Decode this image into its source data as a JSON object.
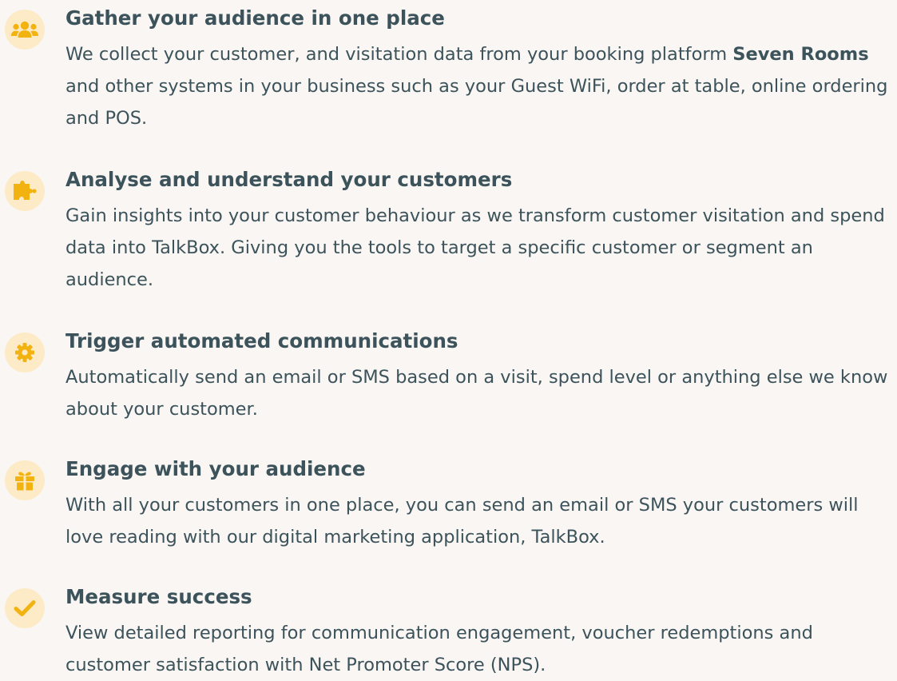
{
  "colors": {
    "background": "#f9f6f3",
    "text": "#3c535b",
    "icon_accent": "#f2b311",
    "icon_badge": "#fdebc7"
  },
  "features": [
    {
      "icon": "users-icon",
      "title": "Gather your audience in one place",
      "desc_part1": "We collect your customer, and visitation data from your booking platform ",
      "desc_bold": "Seven Rooms",
      "desc_part2": " and other systems in your business such as your Guest WiFi, order at table, online ordering and POS."
    },
    {
      "icon": "puzzle-icon",
      "title": "Analyse and understand your customers",
      "desc": "Gain insights into your customer behaviour as we transform customer visitation and spend data into TalkBox. Giving you the tools to target a specific customer or segment an audience."
    },
    {
      "icon": "gear-icon",
      "title": "Trigger automated communications",
      "desc": "Automatically send an email or SMS based on a visit, spend level or anything else we know about your customer."
    },
    {
      "icon": "gift-icon",
      "title": "Engage with your audience",
      "desc": "With all your customers in one place, you can send an email or SMS your customers will love reading with our digital marketing application, TalkBox."
    },
    {
      "icon": "checkmark-icon",
      "title": "Measure success",
      "desc": "View detailed reporting for communication engagement, voucher redemptions and customer satisfaction with Net Promoter Score (NPS)."
    }
  ]
}
